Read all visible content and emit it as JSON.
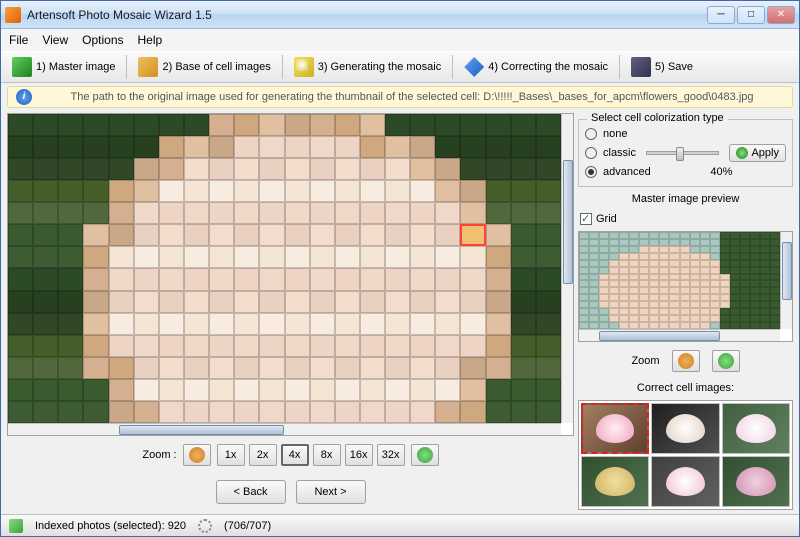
{
  "window": {
    "title": "Artensoft Photo Mosaic Wizard 1.5"
  },
  "menu": {
    "file": "File",
    "view": "View",
    "options": "Options",
    "help": "Help"
  },
  "toolbar": {
    "master": "1) Master image",
    "base": "2) Base of cell images",
    "generate": "3) Generating the mosaic",
    "correct": "4) Correcting the mosaic",
    "save": "5) Save"
  },
  "info": {
    "text": "The path to the original image used for generating the thumbnail of the selected cell: D:\\!!!!!_Bases\\_bases_for_apcm\\flowers_good\\0483.jpg"
  },
  "zoom": {
    "label": "Zoom   :",
    "levels": [
      "1x",
      "2x",
      "4x",
      "8x",
      "16x",
      "32x"
    ],
    "active": "4x"
  },
  "nav": {
    "back": "< Back",
    "next": "Next >"
  },
  "colorization": {
    "title": "Select cell colorization type",
    "none": "none",
    "classic": "classic",
    "advanced": "advanced",
    "selected": "advanced",
    "percent": "40%",
    "apply": "Apply"
  },
  "preview": {
    "title": "Master image preview",
    "grid_label": "Grid",
    "grid_checked": true,
    "zoom_label": "Zoom"
  },
  "correct": {
    "title": "Correct cell images:"
  },
  "status": {
    "indexed": "Indexed photos (selected): 920",
    "progress": "(706/707)"
  }
}
